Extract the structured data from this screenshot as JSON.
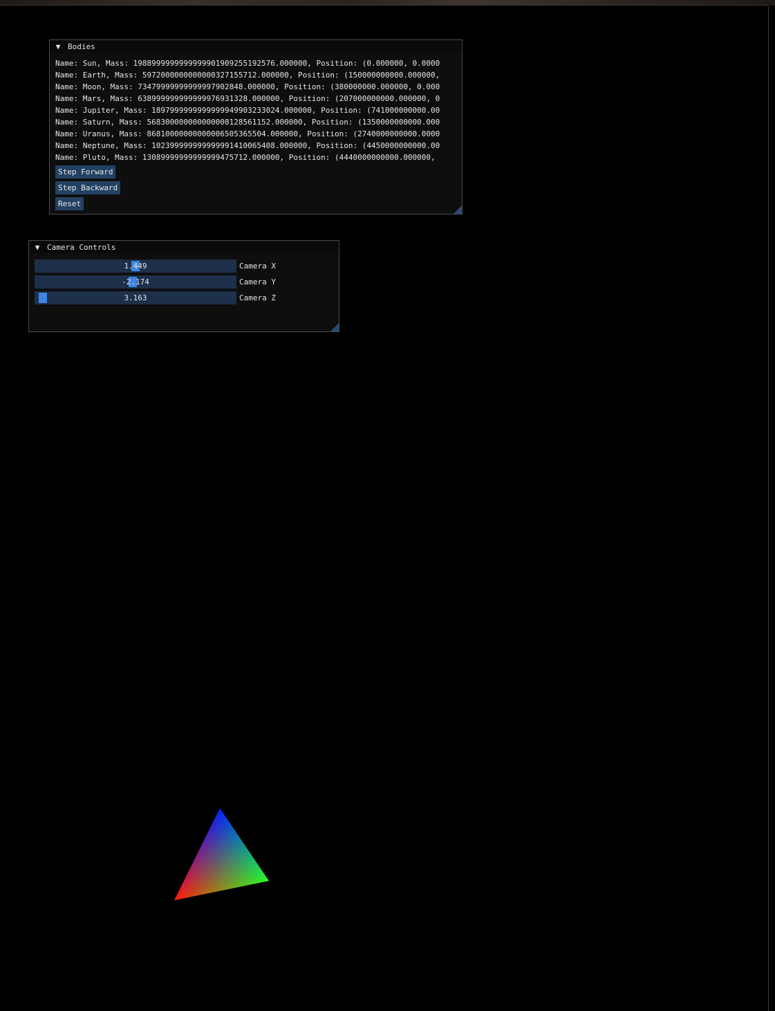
{
  "bodies_window": {
    "title": "Bodies",
    "collapse_glyph": "▼",
    "bodies": [
      "Name: Sun, Mass: 1988999999999999901909255192576.000000, Position: (0.000000, 0.0000",
      "Name: Earth, Mass: 5972000000000000327155712.000000, Position: (150000000000.000000,",
      "Name: Moon, Mass: 73479999999999997902848.000000, Position: (380000000.000000, 0.000",
      "Name: Mars, Mass: 638999999999999976931328.000000, Position: (207000000000.000000, 0",
      "Name: Jupiter, Mass: 1897999999999999949903233024.000000, Position: (741000000000.00",
      "Name: Saturn, Mass: 568300000000000008128561152.000000, Position: (1350000000000.000",
      "Name: Uranus, Mass: 86810000000000006505365504.000000, Position: (2740000000000.0000",
      "Name: Neptune, Mass: 102399999999999991410065408.000000, Position: (4450000000000.00",
      "Name: Pluto, Mass: 13089999999999999475712.000000, Position: (4440000000000.000000,"
    ],
    "buttons": {
      "step_forward": "Step Forward",
      "step_backward": "Step Backward",
      "reset": "Reset"
    }
  },
  "camera_window": {
    "title": "Camera Controls",
    "collapse_glyph": "▼",
    "sliders": {
      "x": {
        "label": "Camera X",
        "value": "1.449",
        "fraction": 0.5
      },
      "y": {
        "label": "Camera Y",
        "value": "-2.174",
        "fraction": 0.485
      },
      "z": {
        "label": "Camera Z",
        "value": "3.163",
        "fraction": 0.015
      }
    }
  },
  "colors": {
    "background": "#000000",
    "window_bg": "#0f0f10",
    "title_bg": "#0a0a0a",
    "button": "#234263",
    "slider_track": "#1d3049",
    "slider_grab": "#3d85e0",
    "text": "#e6e6e6",
    "triangle_top": "#0000ff",
    "triangle_left": "#ff0000",
    "triangle_right": "#00ff00"
  },
  "icons": {
    "collapse": "collapse-arrow-icon",
    "resize": "resize-grip-icon"
  }
}
